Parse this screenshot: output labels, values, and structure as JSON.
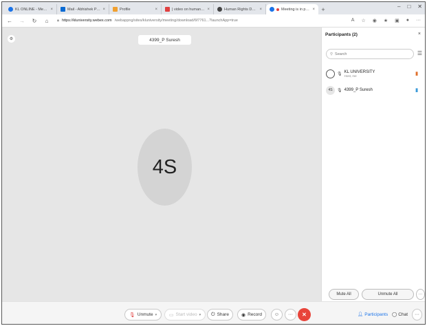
{
  "browser": {
    "tabs": [
      {
        "label": "KL ONLINE - Meeting Owner",
        "color": "#1a73e8",
        "active": false
      },
      {
        "label": "Mail - Abhishek P - Outlook",
        "color": "#0b6bd3",
        "active": false
      },
      {
        "label": "Profile",
        "color": "#f0a030",
        "active": false
      },
      {
        "label": "| video on human rights day - Go",
        "color": "#e04040",
        "active": false
      },
      {
        "label": "Human Rights Day - Wikipedia",
        "color": "#444444",
        "active": false
      },
      {
        "label": "Meeting is in progress...",
        "color": "#1a73e8",
        "active": true
      }
    ],
    "new_tab": "+",
    "window_controls": {
      "minimize": "–",
      "maximize": "□",
      "close": "✕"
    },
    "url_host": "https://kluniversity.webex.com",
    "url_path": "/webappng/sites/kluniversity/meeting/download/6f7761...?launchApp=true"
  },
  "stage": {
    "name_chip": "4399_P Suresh",
    "avatar_initials": "4S"
  },
  "panel": {
    "title": "Participants (2)",
    "close": "×",
    "search_placeholder": "Search",
    "participants": [
      {
        "name": "KL UNIVERSITY",
        "role": "Host, me",
        "initials": "",
        "status_color": "#e0702c"
      },
      {
        "name": "4399_P Suresh",
        "role": "",
        "initials": "4S",
        "status_color": "#3a9ad9"
      }
    ],
    "mute_all": "Mute All",
    "unmute_all": "Unmute All",
    "more": "···"
  },
  "controls": {
    "unmute": "Unmute",
    "start_video": "Start video",
    "share": "Share",
    "record": "Record",
    "more": "···",
    "leave": "✕",
    "participants": "Participants",
    "chat": "Chat",
    "overflow": "···",
    "accent": "#1a73e8",
    "leave_color": "#e8443a"
  }
}
